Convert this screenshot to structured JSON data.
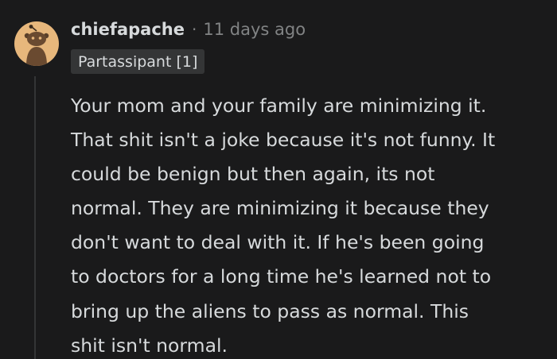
{
  "comment": {
    "author": "chiefapache",
    "separator": "·",
    "timestamp": "11 days ago",
    "flair": "Partassipant [1]",
    "avatar_icon": "snoo-avatar-icon",
    "body_lines": [
      "Your mom and your family are minimizing it.",
      "That shit isn't a joke because it's not funny. It",
      "could be benign but then again, its not",
      "normal. They are minimizing it because they",
      "don't want to deal with it. If he's been going",
      "to doctors for a long time he's learned not to",
      "bring up the aliens to pass as normal. This",
      "shit isn't normal."
    ]
  },
  "colors": {
    "background": "#1a1a1b",
    "text": "#d7dadc",
    "muted": "#818384",
    "flair_bg": "#343536",
    "avatar_bg": "#e7b77c"
  }
}
